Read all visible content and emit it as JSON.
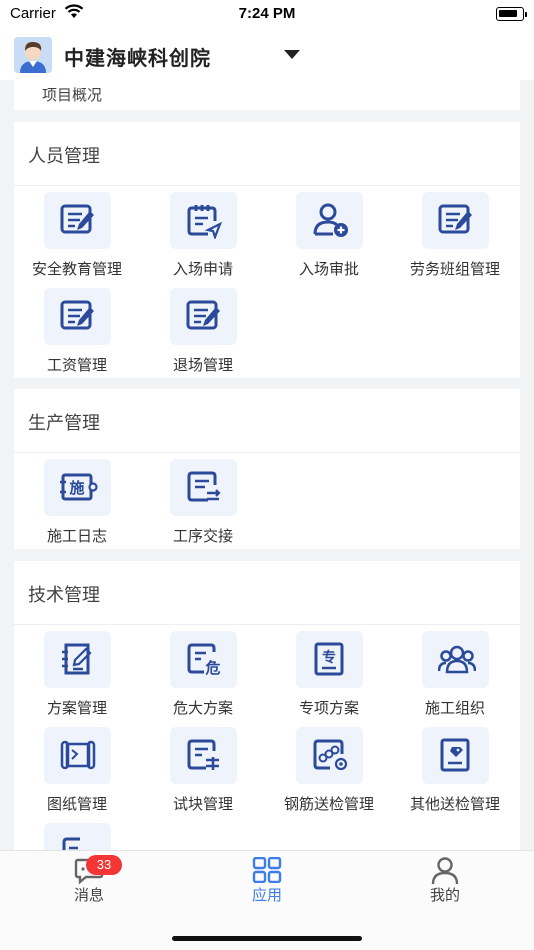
{
  "status_bar": {
    "carrier": "Carrier",
    "time": "7:24 PM"
  },
  "header": {
    "org_name": "中建海峡科创院"
  },
  "overview": {
    "label": "项目概况"
  },
  "sections": [
    {
      "title": "人员管理",
      "items": [
        {
          "label": "安全教育管理",
          "icon": "edit-doc-icon"
        },
        {
          "label": "入场申请",
          "icon": "clipboard-send-icon"
        },
        {
          "label": "入场审批",
          "icon": "user-add-icon"
        },
        {
          "label": "劳务班组管理",
          "icon": "edit-doc-icon"
        },
        {
          "label": "工资管理",
          "icon": "edit-doc-icon"
        },
        {
          "label": "退场管理",
          "icon": "edit-doc-icon"
        }
      ]
    },
    {
      "title": "生产管理",
      "items": [
        {
          "label": "施工日志",
          "icon": "construction-log-icon"
        },
        {
          "label": "工序交接",
          "icon": "handover-doc-icon"
        }
      ]
    },
    {
      "title": "技术管理",
      "items": [
        {
          "label": "方案管理",
          "icon": "notebook-pen-icon"
        },
        {
          "label": "危大方案",
          "icon": "danger-doc-icon"
        },
        {
          "label": "专项方案",
          "icon": "special-doc-icon"
        },
        {
          "label": "施工组织",
          "icon": "team-icon"
        },
        {
          "label": "图纸管理",
          "icon": "scroll-map-icon"
        },
        {
          "label": "试块管理",
          "icon": "test-block-icon"
        },
        {
          "label": "钢筋送检管理",
          "icon": "rebar-inspect-icon"
        },
        {
          "label": "其他送检管理",
          "icon": "tag-doc-icon"
        },
        {
          "label": "",
          "icon": "partial-doc-icon"
        }
      ]
    }
  ],
  "tab_bar": {
    "tabs": [
      {
        "label": "消息",
        "icon": "message-icon",
        "badge": "33"
      },
      {
        "label": "应用",
        "icon": "apps-grid-icon"
      },
      {
        "label": "我的",
        "icon": "person-icon"
      }
    ]
  },
  "colors": {
    "accent": "#3d7de8",
    "icon_blue": "#2b4a9a",
    "icon_bg": "#eff3fb",
    "badge": "#f23535"
  }
}
